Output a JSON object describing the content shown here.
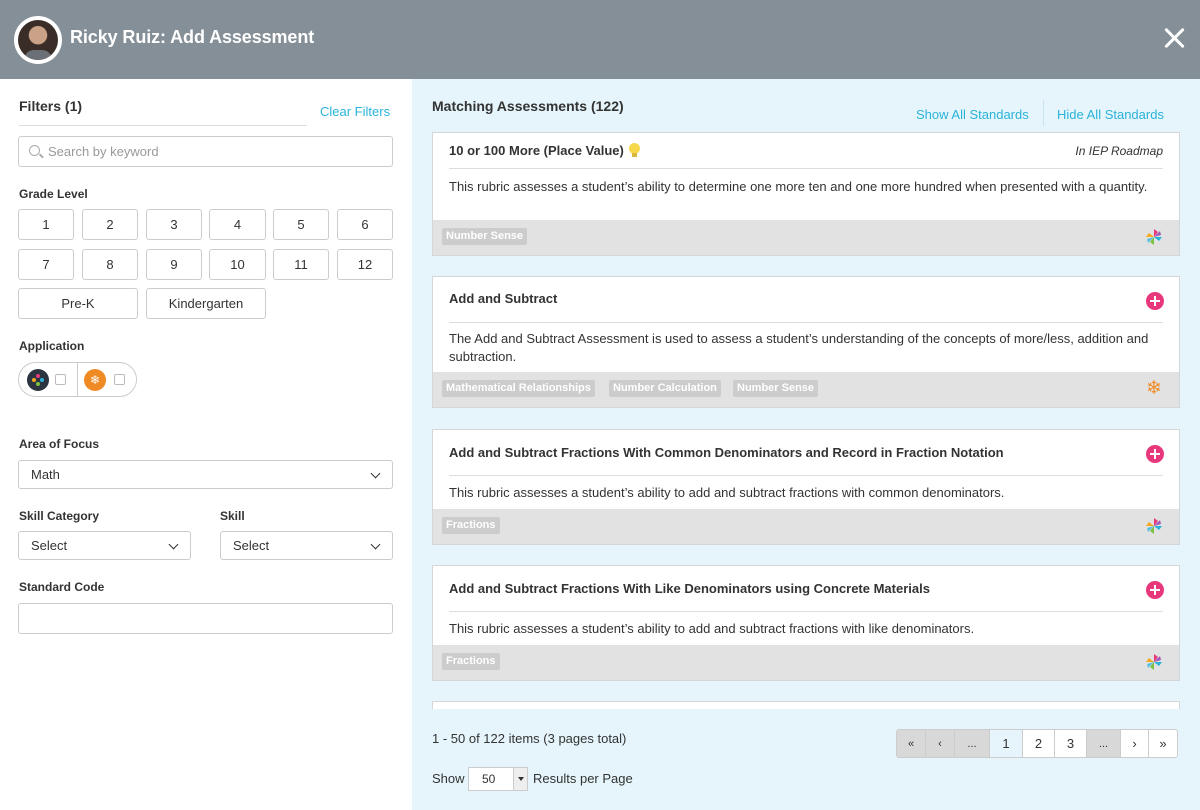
{
  "header": {
    "title": "Ricky Ruiz: Add Assessment",
    "close_icon": "close-icon"
  },
  "filters": {
    "title": "Filters (1)",
    "clear_label": "Clear Filters",
    "search_placeholder": "Search by keyword",
    "grade_level_label": "Grade Level",
    "grades": [
      "1",
      "2",
      "3",
      "4",
      "5",
      "6",
      "7",
      "8",
      "9",
      "10",
      "11",
      "12",
      "Pre-K",
      "Kindergarten"
    ],
    "application_label": "Application",
    "applications": [
      {
        "icon": "assessment-app-icon",
        "color": "#2b3440",
        "checked": false
      },
      {
        "icon": "snowflake-app-icon",
        "color": "#f08a24",
        "checked": false
      }
    ],
    "area_of_focus_label": "Area of Focus",
    "area_of_focus_value": "Math",
    "skill_category_label": "Skill Category",
    "skill_category_value": "Select",
    "skill_label": "Skill",
    "skill_value": "Select",
    "standard_code_label": "Standard Code",
    "standard_code_value": ""
  },
  "results": {
    "title": "Matching Assessments (122)",
    "show_all_label": "Show All Standards",
    "hide_all_label": "Hide All Standards",
    "cards": [
      {
        "title": "10 or 100 More (Place Value)",
        "roadmap": "In IEP Roadmap",
        "description": "This rubric assesses a student’s ability to determine one more ten and one more hundred when presented with a quantity.",
        "tags": [
          "Number Sense"
        ],
        "app_icon": "pinwheel-icon"
      },
      {
        "title": "Add and Subtract",
        "description": "The Add and Subtract Assessment is used to assess a student’s understanding of the concepts of more/less, addition and subtraction.",
        "tags": [
          "Mathematical Relationships",
          "Number Calculation",
          "Number Sense"
        ],
        "app_icon": "snowflake-icon"
      },
      {
        "title": "Add and Subtract Fractions With Common Denominators and Record in Fraction Notation",
        "description": "This rubric assesses a student’s ability to add and subtract fractions with common denominators.",
        "tags": [
          "Fractions"
        ],
        "app_icon": "pinwheel-icon"
      },
      {
        "title": "Add and Subtract Fractions With Like Denominators using Concrete Materials",
        "description": "This rubric assesses a student’s ability to add and subtract fractions with like denominators.",
        "tags": [
          "Fractions"
        ],
        "app_icon": "pinwheel-icon"
      }
    ]
  },
  "pagination": {
    "items_text": "1 - 50 of 122 items (3 pages total)",
    "first": "«",
    "prev": "‹",
    "ellipsis": "...",
    "pages": [
      "1",
      "2",
      "3"
    ],
    "current_page": "1",
    "next": "›",
    "last": "»",
    "show_label": "Show",
    "per_page_value": "50",
    "results_label": "Results per Page"
  },
  "colors": {
    "header_bg": "#858f98",
    "accent_link": "#2ab3d9",
    "add_button": "#e8387c",
    "right_panel_bg": "#e5f5fb"
  }
}
